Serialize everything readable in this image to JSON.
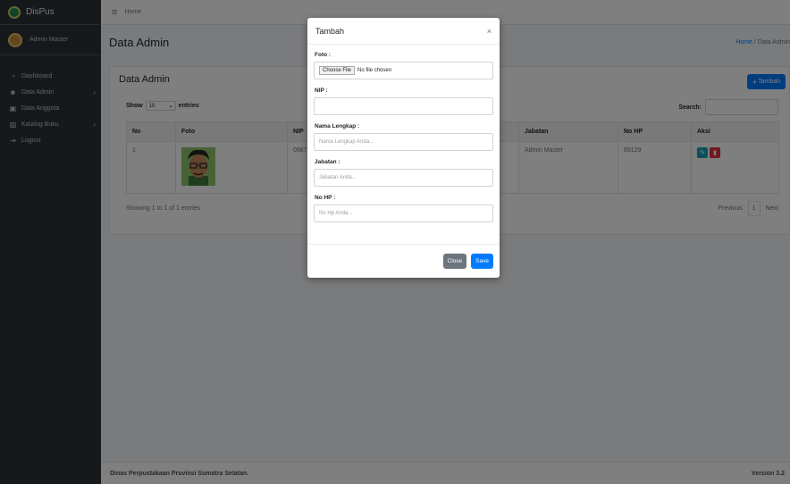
{
  "sidebar": {
    "brand": "DisPus",
    "user": "Admin Master",
    "items": [
      {
        "label": "Dashboard",
        "icon": "dashboard-icon"
      },
      {
        "label": "Data Admin",
        "icon": "users-icon"
      },
      {
        "label": "Data Anggota",
        "icon": "id-card-icon"
      },
      {
        "label": "Katalog Buku",
        "icon": "books-icon"
      },
      {
        "label": "Logout",
        "icon": "logout-icon"
      }
    ]
  },
  "topbar": {
    "home_link": "Home"
  },
  "page": {
    "title": "Data Admin",
    "breadcrumb_home": "Home",
    "breadcrumb_sep": "/",
    "breadcrumb_current": "Data Admin"
  },
  "card": {
    "title": "Data Admin",
    "add_button": "Tambah",
    "show_label": "Show",
    "show_value": "10",
    "entries_label": "entries",
    "search_label": "Search:",
    "columns": [
      "No",
      "Foto",
      "NIP",
      "Jabatan",
      "No HP",
      "Aksi"
    ],
    "rows": [
      {
        "no": "1",
        "nip": "09876",
        "jabatan": "Admin Master",
        "nohp": "89129"
      }
    ],
    "showing": "Showing 1 to 1 of 1 entries",
    "prev": "Previous",
    "page": "1",
    "next": "Next"
  },
  "footer": {
    "left": "Dinas Perpustakaan Provinsi Sumatra Selatan.",
    "right": "Version 3.2"
  },
  "modal": {
    "title": "Tambah",
    "close_symbol": "×",
    "foto_label": "Foto :",
    "file_button": "Choose File",
    "file_status": "No file chosen",
    "nip_label": "NIP :",
    "nama_label": "Nama Lengkap :",
    "nama_placeholder": "Nama Lengkap Anda...",
    "jabatan_label": "Jabatan :",
    "jabatan_placeholder": "Jabatan Anda...",
    "nohp_label": "No HP :",
    "nohp_placeholder": "No Hp Anda...",
    "close_button": "Close",
    "save_button": "Save"
  },
  "colors": {
    "sidebar_bg": "#2d3237",
    "primary": "#007bff",
    "secondary": "#6c757d",
    "edit": "#17a2b8",
    "delete": "#dc3545"
  }
}
